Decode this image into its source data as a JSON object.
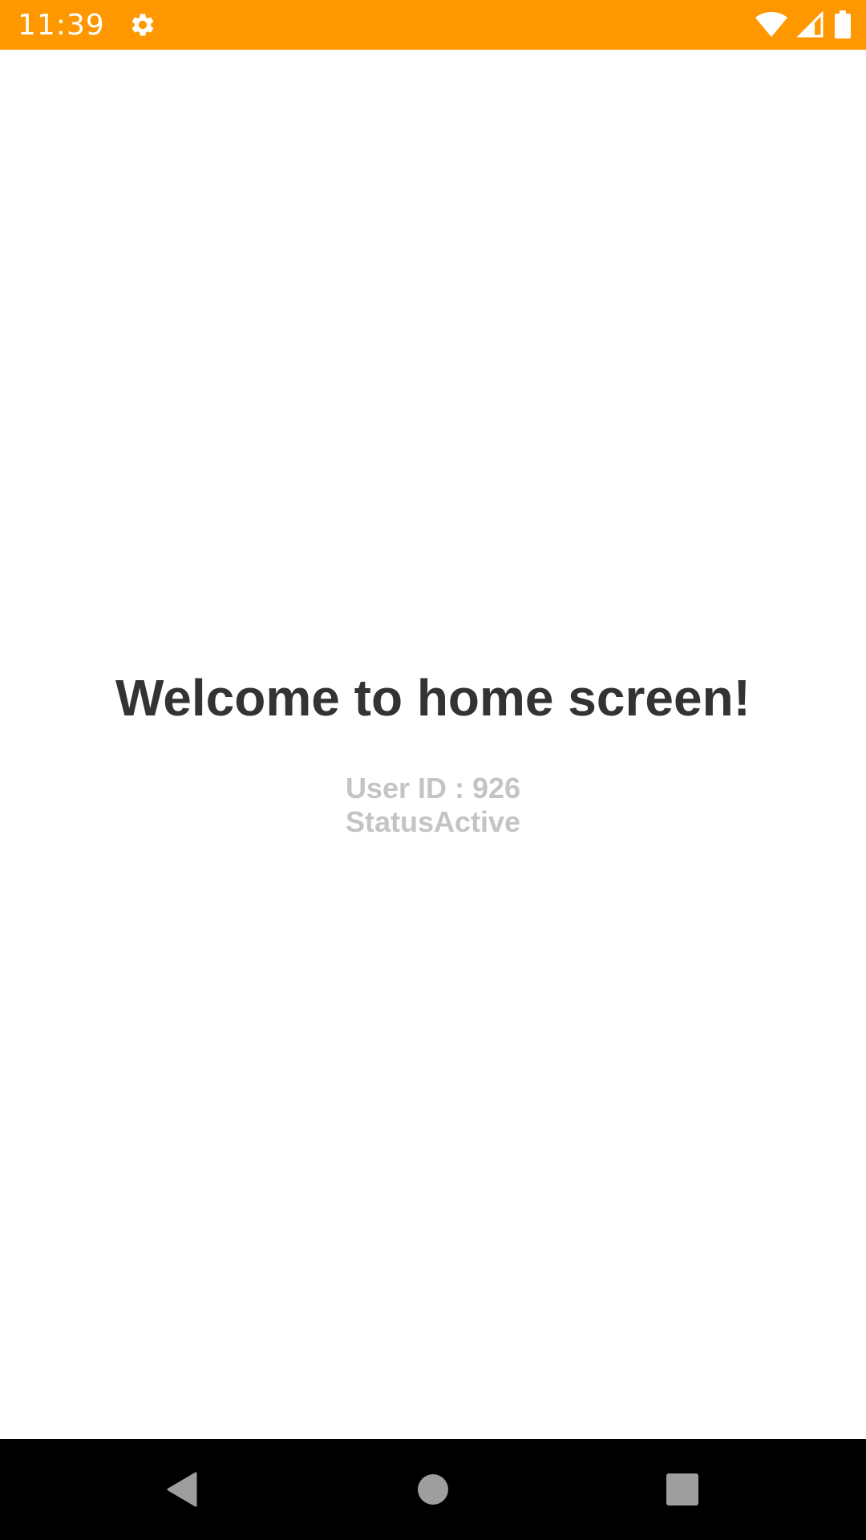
{
  "status_bar": {
    "time": "11:39",
    "background_color": "#FF9800",
    "icons": [
      "settings-gear-icon",
      "wifi-icon",
      "cellular-signal-icon",
      "battery-icon"
    ]
  },
  "main": {
    "title": "Welcome to home screen!",
    "user_id_line": "User ID : 926",
    "status_line": "StatusActive",
    "title_color": "#333333",
    "info_color": "#C4C4C4"
  },
  "nav_bar": {
    "buttons": [
      "back-icon",
      "home-icon",
      "recents-icon"
    ]
  }
}
